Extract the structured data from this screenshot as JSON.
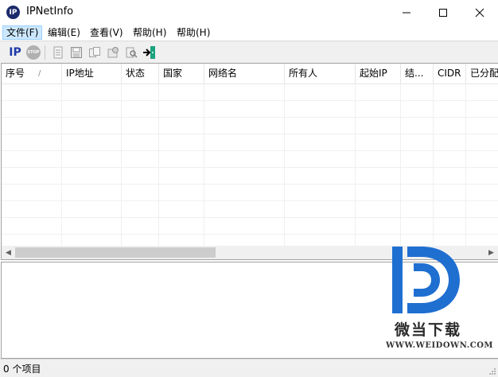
{
  "window": {
    "title": "IPNetInfo",
    "icon_text": "IP"
  },
  "menu": [
    {
      "label": "文件(F)"
    },
    {
      "label": "编辑(E)"
    },
    {
      "label": "查看(V)"
    },
    {
      "label": "帮助(H)"
    },
    {
      "label": "帮助(H)"
    }
  ],
  "toolbar": {
    "ip_label": "IP",
    "stop_label": "STOP"
  },
  "columns": [
    {
      "label": "序号",
      "sort": "/"
    },
    {
      "label": "IP地址"
    },
    {
      "label": "状态"
    },
    {
      "label": "国家"
    },
    {
      "label": "网络名"
    },
    {
      "label": "所有人"
    },
    {
      "label": "起始IP"
    },
    {
      "label": "结..."
    },
    {
      "label": "CIDR"
    },
    {
      "label": "已分配"
    }
  ],
  "status": {
    "text": "0 个项目"
  },
  "watermark": {
    "name": "微当下载",
    "url": "WWW.WEIDOWN.COM"
  }
}
